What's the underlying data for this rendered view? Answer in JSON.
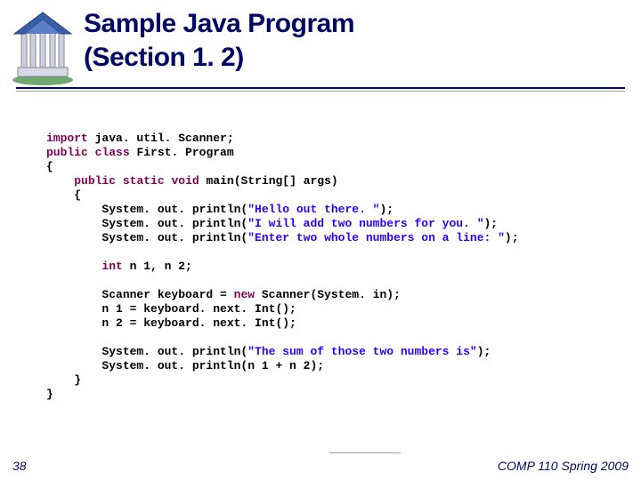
{
  "slide": {
    "title_line1": "Sample Java Program",
    "title_line2": "(Section 1. 2)"
  },
  "code": {
    "l1a": "import",
    "l1b": " java. util. Scanner;",
    "l2a": "public",
    "l2b": " ",
    "l2c": "class",
    "l2d": " First. Program",
    "l3": "{",
    "l4a": "    ",
    "l4b": "public",
    "l4c": " ",
    "l4d": "static",
    "l4e": " ",
    "l4f": "void",
    "l4g": " main(String[] args)",
    "l5": "    {",
    "l6a": "        System. out. println(",
    "l6b": "\"Hello out there. \"",
    "l6c": ");",
    "l7a": "        System. out. println(",
    "l7b": "\"I will add two numbers for you. \"",
    "l7c": ");",
    "l8a": "        System. out. println(",
    "l8b": "\"Enter two whole numbers on a line: \"",
    "l8c": ");",
    "blank1": "",
    "l9a": "        ",
    "l9b": "int",
    "l9c": " n 1, n 2;",
    "blank2": "",
    "l10a": "        Scanner keyboard = ",
    "l10b": "new",
    "l10c": " Scanner(System. in);",
    "l11": "        n 1 = keyboard. next. Int();",
    "l12": "        n 2 = keyboard. next. Int();",
    "blank3": "",
    "l13a": "        System. out. println(",
    "l13b": "\"The sum of those two numbers is\"",
    "l13c": ");",
    "l14": "        System. out. println(n 1 + n 2);",
    "l15": "    }",
    "l16": "}"
  },
  "footer": {
    "page": "38",
    "course": "COMP 110 Spring 2009"
  }
}
